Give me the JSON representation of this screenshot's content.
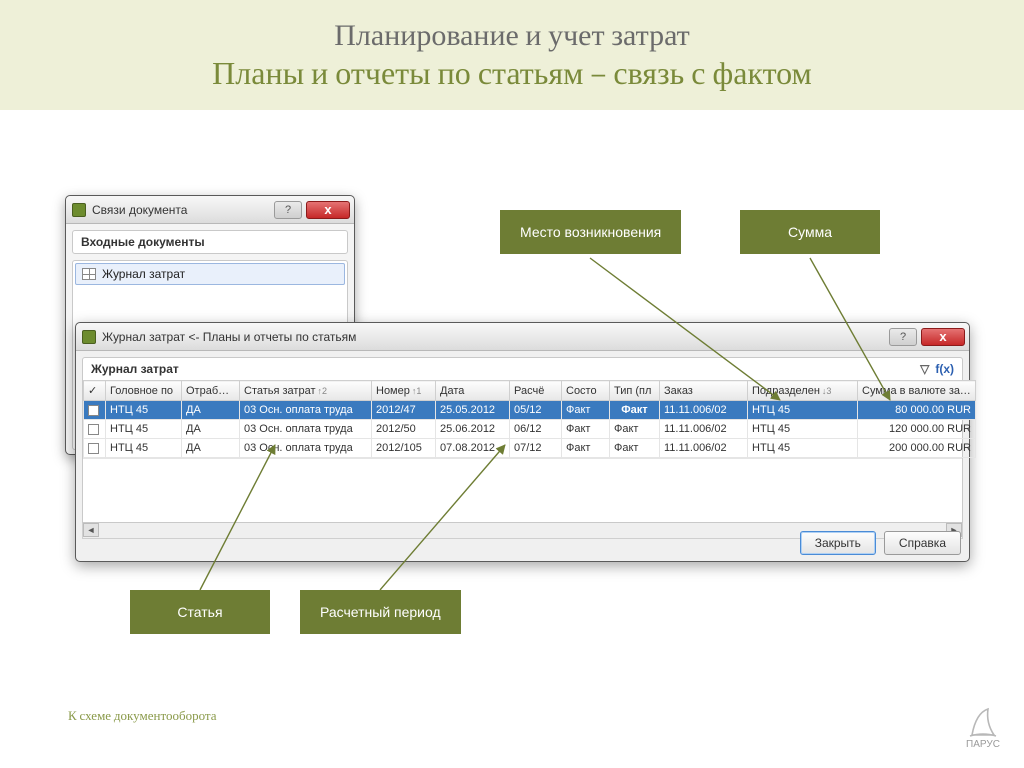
{
  "slide": {
    "title": "Планирование и учет затрат",
    "subtitle": "Планы и отчеты по статьям – связь с фактом",
    "schema_link": "К схеме документооборота",
    "logo_caption": "ПАРУС"
  },
  "callouts": {
    "place": "Место возникновения",
    "amount": "Сумма",
    "article": "Статья",
    "period": "Расчетный период"
  },
  "dlg_links": {
    "title": "Связи документа",
    "section": "Входные документы",
    "item": "Журнал затрат",
    "help": "?",
    "close": "x"
  },
  "dlg_journal": {
    "title": "Журнал затрат <- Планы и отчеты по статьям",
    "panel": "Журнал затрат",
    "fx": "f(x)",
    "filter_icon": "▽",
    "btn_close": "Закрыть",
    "btn_help": "Справка"
  },
  "grid": {
    "headers": {
      "chk": "✓",
      "hq": "Головное по",
      "proc": "Отработан",
      "article": "Статья затрат",
      "num": "Номер",
      "date": "Дата",
      "calc": "Расчё",
      "status": "Состо",
      "type": "Тип (пл",
      "order": "Заказ",
      "dept": "Подразделен",
      "amount": "Сумма в валюте затра"
    },
    "sort_arrows": {
      "article": "↑2",
      "num": "↑1",
      "dept": "↓3"
    },
    "rows": [
      {
        "hq": "НТЦ 45",
        "proc": "ДА",
        "article": "03 Осн. оплата труда",
        "num": "2012/47",
        "date": "25.05.2012",
        "calc": "05/12",
        "status": "Факт",
        "type": "Факт",
        "order": "11.11.006/02",
        "dept": "НТЦ 45",
        "amount": "80 000.00 RUR",
        "selected": true,
        "type_hl": true
      },
      {
        "hq": "НТЦ 45",
        "proc": "ДА",
        "article": "03 Осн. оплата труда",
        "num": "2012/50",
        "date": "25.06.2012",
        "calc": "06/12",
        "status": "Факт",
        "type": "Факт",
        "order": "11.11.006/02",
        "dept": "НТЦ 45",
        "amount": "120 000.00 RUR"
      },
      {
        "hq": "НТЦ 45",
        "proc": "ДА",
        "article": "03 Осн. оплата труда",
        "num": "2012/105",
        "date": "07.08.2012",
        "calc": "07/12",
        "status": "Факт",
        "type": "Факт",
        "order": "11.11.006/02",
        "dept": "НТЦ 45",
        "amount": "200 000.00 RUR"
      }
    ]
  }
}
